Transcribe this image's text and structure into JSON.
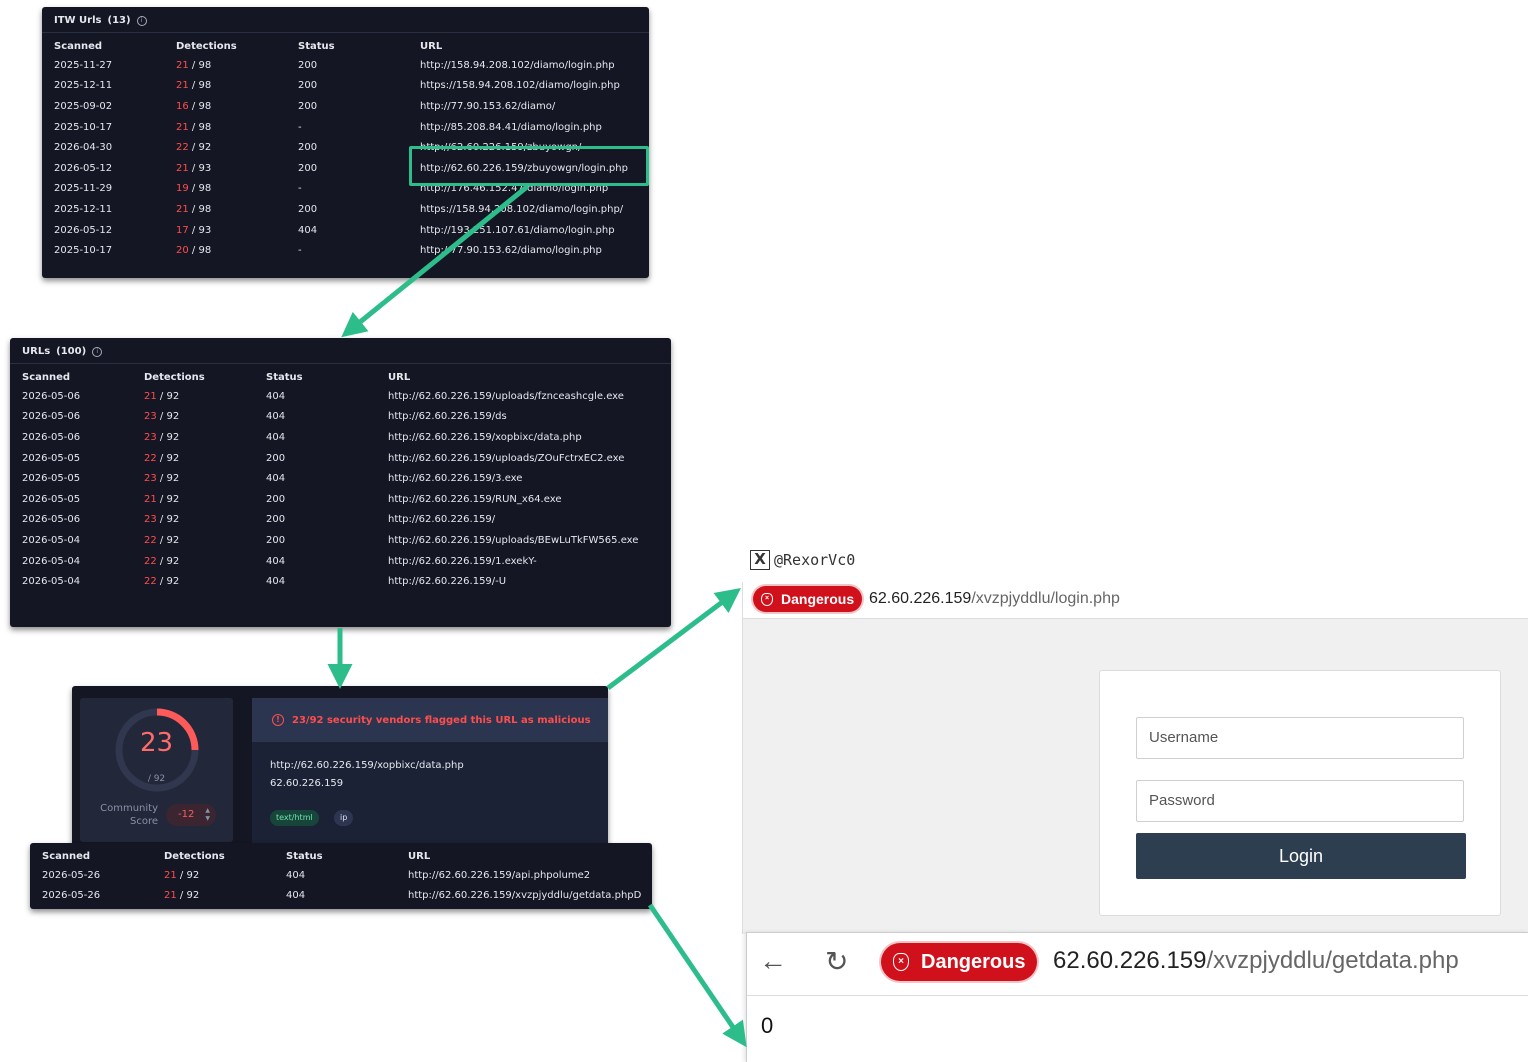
{
  "itw_panel": {
    "title": "ITW Urls",
    "count": "(13)",
    "headers": [
      "Scanned",
      "Detections",
      "Status",
      "URL"
    ],
    "rows": [
      {
        "scanned": "2025-11-27",
        "det": "21",
        "total": "/ 98",
        "status": "200",
        "url": "http://158.94.208.102/diamo/login.php"
      },
      {
        "scanned": "2025-12-11",
        "det": "21",
        "total": "/ 98",
        "status": "200",
        "url": "https://158.94.208.102/diamo/login.php"
      },
      {
        "scanned": "2025-09-02",
        "det": "16",
        "total": "/ 98",
        "status": "200",
        "url": "http://77.90.153.62/diamo/"
      },
      {
        "scanned": "2025-10-17",
        "det": "21",
        "total": "/ 98",
        "status": "-",
        "url": "http://85.208.84.41/diamo/login.php"
      },
      {
        "scanned": "2026-04-30",
        "det": "22",
        "total": "/ 92",
        "status": "200",
        "url": "http://62.60.226.159/zbuyowgn/"
      },
      {
        "scanned": "2026-05-12",
        "det": "21",
        "total": "/ 93",
        "status": "200",
        "url": "http://62.60.226.159/zbuyowgn/login.php"
      },
      {
        "scanned": "2025-11-29",
        "det": "19",
        "total": "/ 98",
        "status": "-",
        "url": "http://176.46.152.47/diamo/login.php"
      },
      {
        "scanned": "2025-12-11",
        "det": "21",
        "total": "/ 98",
        "status": "200",
        "url": "https://158.94.208.102/diamo/login.php/"
      },
      {
        "scanned": "2026-05-12",
        "det": "17",
        "total": "/ 93",
        "status": "404",
        "url": "http://193.251.107.61/diamo/login.php"
      },
      {
        "scanned": "2025-10-17",
        "det": "20",
        "total": "/ 98",
        "status": "-",
        "url": "http://77.90.153.62/diamo/login.php"
      }
    ]
  },
  "urls_panel": {
    "title": "URLs",
    "count": "(100)",
    "headers": [
      "Scanned",
      "Detections",
      "Status",
      "URL"
    ],
    "rows": [
      {
        "scanned": "2026-05-06",
        "det": "21",
        "total": "/ 92",
        "status": "404",
        "url": "http://62.60.226.159/uploads/fznceashcgle.exe"
      },
      {
        "scanned": "2026-05-06",
        "det": "23",
        "total": "/ 92",
        "status": "404",
        "url": "http://62.60.226.159/ds"
      },
      {
        "scanned": "2026-05-06",
        "det": "23",
        "total": "/ 92",
        "status": "404",
        "url": "http://62.60.226.159/xopbixc/data.php"
      },
      {
        "scanned": "2026-05-05",
        "det": "22",
        "total": "/ 92",
        "status": "200",
        "url": "http://62.60.226.159/uploads/ZOuFctrxEC2.exe"
      },
      {
        "scanned": "2026-05-05",
        "det": "23",
        "total": "/ 92",
        "status": "404",
        "url": "http://62.60.226.159/3.exe"
      },
      {
        "scanned": "2026-05-05",
        "det": "21",
        "total": "/ 92",
        "status": "200",
        "url": "http://62.60.226.159/RUN_x64.exe"
      },
      {
        "scanned": "2026-05-06",
        "det": "23",
        "total": "/ 92",
        "status": "200",
        "url": "http://62.60.226.159/"
      },
      {
        "scanned": "2026-05-04",
        "det": "22",
        "total": "/ 92",
        "status": "200",
        "url": "http://62.60.226.159/uploads/BEwLuTkFW565.exe"
      },
      {
        "scanned": "2026-05-04",
        "det": "22",
        "total": "/ 92",
        "status": "404",
        "url": "http://62.60.226.159/1.exekY-"
      },
      {
        "scanned": "2026-05-04",
        "det": "22",
        "total": "/ 92",
        "status": "404",
        "url": "http://62.60.226.159/-U"
      }
    ]
  },
  "summary": {
    "score": "23",
    "score_total": "/ 92",
    "score_fraction": 0.25,
    "community_label_1": "Community",
    "community_label_2": "Score",
    "community_value": "-12",
    "alert": "23/92 security vendors flagged this URL as malicious",
    "url": "http://62.60.226.159/xopbixc/data.php",
    "ip": "62.60.226.159",
    "tags": [
      "text/html",
      "ip"
    ]
  },
  "bottom_table": {
    "headers": [
      "Scanned",
      "Detections",
      "Status",
      "URL"
    ],
    "rows": [
      {
        "scanned": "2026-05-26",
        "det": "21",
        "total": "/ 92",
        "status": "404",
        "url": "http://62.60.226.159/api.phpolume2"
      },
      {
        "scanned": "2026-05-26",
        "det": "21",
        "total": "/ 92",
        "status": "404",
        "url": "http://62.60.226.159/xvzpjyddlu/getdata.phpD"
      }
    ]
  },
  "handle": "@RexorVc0",
  "browser_login": {
    "danger_label": "Dangerous",
    "url_host": "62.60.226.159",
    "url_path": "/xvzpjyddlu/login.php",
    "username_placeholder": "Username",
    "password_placeholder": "Password",
    "login_label": "Login"
  },
  "browser_getdata": {
    "back_icon": "←",
    "reload_icon": "↻",
    "danger_label": "Dangerous",
    "url_host": "62.60.226.159",
    "url_path": "/xvzpjyddlu/getdata.php",
    "page_content": "0"
  },
  "colors": {
    "panel_bg": "#141624",
    "detection_red": "#ff4d4d",
    "arrow_green": "#2dbd8a",
    "danger_red": "#d0111c",
    "login_button": "#2c3e50"
  }
}
